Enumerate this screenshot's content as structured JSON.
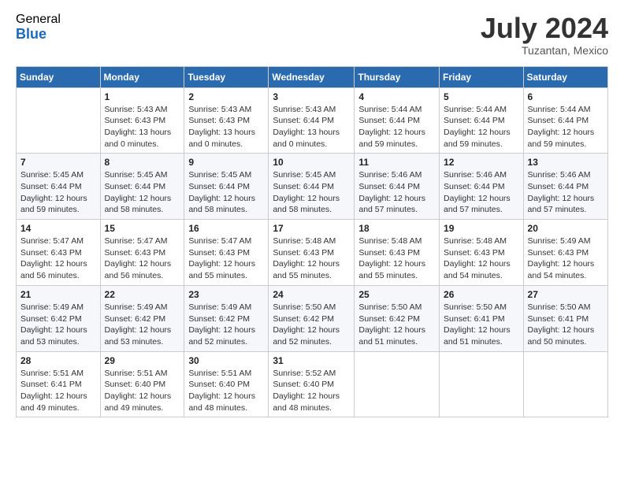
{
  "logo": {
    "general": "General",
    "blue": "Blue"
  },
  "title": "July 2024",
  "location": "Tuzantan, Mexico",
  "days_of_week": [
    "Sunday",
    "Monday",
    "Tuesday",
    "Wednesday",
    "Thursday",
    "Friday",
    "Saturday"
  ],
  "weeks": [
    [
      {
        "day": "",
        "sunrise": "",
        "sunset": "",
        "daylight": ""
      },
      {
        "day": "1",
        "sunrise": "Sunrise: 5:43 AM",
        "sunset": "Sunset: 6:43 PM",
        "daylight": "Daylight: 13 hours and 0 minutes."
      },
      {
        "day": "2",
        "sunrise": "Sunrise: 5:43 AM",
        "sunset": "Sunset: 6:43 PM",
        "daylight": "Daylight: 13 hours and 0 minutes."
      },
      {
        "day": "3",
        "sunrise": "Sunrise: 5:43 AM",
        "sunset": "Sunset: 6:44 PM",
        "daylight": "Daylight: 13 hours and 0 minutes."
      },
      {
        "day": "4",
        "sunrise": "Sunrise: 5:44 AM",
        "sunset": "Sunset: 6:44 PM",
        "daylight": "Daylight: 12 hours and 59 minutes."
      },
      {
        "day": "5",
        "sunrise": "Sunrise: 5:44 AM",
        "sunset": "Sunset: 6:44 PM",
        "daylight": "Daylight: 12 hours and 59 minutes."
      },
      {
        "day": "6",
        "sunrise": "Sunrise: 5:44 AM",
        "sunset": "Sunset: 6:44 PM",
        "daylight": "Daylight: 12 hours and 59 minutes."
      }
    ],
    [
      {
        "day": "7",
        "sunrise": "Sunrise: 5:45 AM",
        "sunset": "Sunset: 6:44 PM",
        "daylight": "Daylight: 12 hours and 59 minutes."
      },
      {
        "day": "8",
        "sunrise": "Sunrise: 5:45 AM",
        "sunset": "Sunset: 6:44 PM",
        "daylight": "Daylight: 12 hours and 58 minutes."
      },
      {
        "day": "9",
        "sunrise": "Sunrise: 5:45 AM",
        "sunset": "Sunset: 6:44 PM",
        "daylight": "Daylight: 12 hours and 58 minutes."
      },
      {
        "day": "10",
        "sunrise": "Sunrise: 5:45 AM",
        "sunset": "Sunset: 6:44 PM",
        "daylight": "Daylight: 12 hours and 58 minutes."
      },
      {
        "day": "11",
        "sunrise": "Sunrise: 5:46 AM",
        "sunset": "Sunset: 6:44 PM",
        "daylight": "Daylight: 12 hours and 57 minutes."
      },
      {
        "day": "12",
        "sunrise": "Sunrise: 5:46 AM",
        "sunset": "Sunset: 6:44 PM",
        "daylight": "Daylight: 12 hours and 57 minutes."
      },
      {
        "day": "13",
        "sunrise": "Sunrise: 5:46 AM",
        "sunset": "Sunset: 6:44 PM",
        "daylight": "Daylight: 12 hours and 57 minutes."
      }
    ],
    [
      {
        "day": "14",
        "sunrise": "Sunrise: 5:47 AM",
        "sunset": "Sunset: 6:43 PM",
        "daylight": "Daylight: 12 hours and 56 minutes."
      },
      {
        "day": "15",
        "sunrise": "Sunrise: 5:47 AM",
        "sunset": "Sunset: 6:43 PM",
        "daylight": "Daylight: 12 hours and 56 minutes."
      },
      {
        "day": "16",
        "sunrise": "Sunrise: 5:47 AM",
        "sunset": "Sunset: 6:43 PM",
        "daylight": "Daylight: 12 hours and 55 minutes."
      },
      {
        "day": "17",
        "sunrise": "Sunrise: 5:48 AM",
        "sunset": "Sunset: 6:43 PM",
        "daylight": "Daylight: 12 hours and 55 minutes."
      },
      {
        "day": "18",
        "sunrise": "Sunrise: 5:48 AM",
        "sunset": "Sunset: 6:43 PM",
        "daylight": "Daylight: 12 hours and 55 minutes."
      },
      {
        "day": "19",
        "sunrise": "Sunrise: 5:48 AM",
        "sunset": "Sunset: 6:43 PM",
        "daylight": "Daylight: 12 hours and 54 minutes."
      },
      {
        "day": "20",
        "sunrise": "Sunrise: 5:49 AM",
        "sunset": "Sunset: 6:43 PM",
        "daylight": "Daylight: 12 hours and 54 minutes."
      }
    ],
    [
      {
        "day": "21",
        "sunrise": "Sunrise: 5:49 AM",
        "sunset": "Sunset: 6:42 PM",
        "daylight": "Daylight: 12 hours and 53 minutes."
      },
      {
        "day": "22",
        "sunrise": "Sunrise: 5:49 AM",
        "sunset": "Sunset: 6:42 PM",
        "daylight": "Daylight: 12 hours and 53 minutes."
      },
      {
        "day": "23",
        "sunrise": "Sunrise: 5:49 AM",
        "sunset": "Sunset: 6:42 PM",
        "daylight": "Daylight: 12 hours and 52 minutes."
      },
      {
        "day": "24",
        "sunrise": "Sunrise: 5:50 AM",
        "sunset": "Sunset: 6:42 PM",
        "daylight": "Daylight: 12 hours and 52 minutes."
      },
      {
        "day": "25",
        "sunrise": "Sunrise: 5:50 AM",
        "sunset": "Sunset: 6:42 PM",
        "daylight": "Daylight: 12 hours and 51 minutes."
      },
      {
        "day": "26",
        "sunrise": "Sunrise: 5:50 AM",
        "sunset": "Sunset: 6:41 PM",
        "daylight": "Daylight: 12 hours and 51 minutes."
      },
      {
        "day": "27",
        "sunrise": "Sunrise: 5:50 AM",
        "sunset": "Sunset: 6:41 PM",
        "daylight": "Daylight: 12 hours and 50 minutes."
      }
    ],
    [
      {
        "day": "28",
        "sunrise": "Sunrise: 5:51 AM",
        "sunset": "Sunset: 6:41 PM",
        "daylight": "Daylight: 12 hours and 49 minutes."
      },
      {
        "day": "29",
        "sunrise": "Sunrise: 5:51 AM",
        "sunset": "Sunset: 6:40 PM",
        "daylight": "Daylight: 12 hours and 49 minutes."
      },
      {
        "day": "30",
        "sunrise": "Sunrise: 5:51 AM",
        "sunset": "Sunset: 6:40 PM",
        "daylight": "Daylight: 12 hours and 48 minutes."
      },
      {
        "day": "31",
        "sunrise": "Sunrise: 5:52 AM",
        "sunset": "Sunset: 6:40 PM",
        "daylight": "Daylight: 12 hours and 48 minutes."
      },
      {
        "day": "",
        "sunrise": "",
        "sunset": "",
        "daylight": ""
      },
      {
        "day": "",
        "sunrise": "",
        "sunset": "",
        "daylight": ""
      },
      {
        "day": "",
        "sunrise": "",
        "sunset": "",
        "daylight": ""
      }
    ]
  ]
}
